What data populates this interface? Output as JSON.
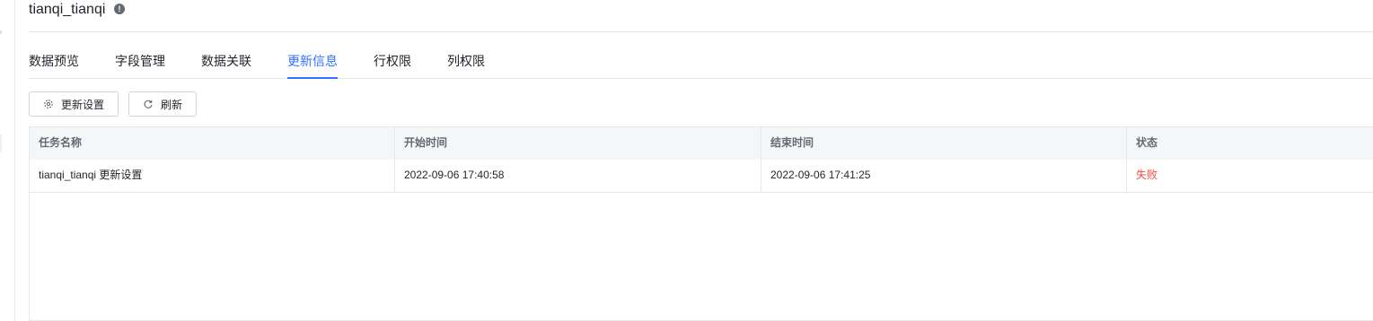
{
  "header": {
    "title": "tianqi_tianqi",
    "info_icon": "info-icon"
  },
  "tabs": [
    {
      "label": "数据预览",
      "active": false
    },
    {
      "label": "字段管理",
      "active": false
    },
    {
      "label": "数据关联",
      "active": false
    },
    {
      "label": "更新信息",
      "active": true
    },
    {
      "label": "行权限",
      "active": false
    },
    {
      "label": "列权限",
      "active": false
    }
  ],
  "toolbar": {
    "settings_label": "更新设置",
    "settings_icon": "gear-icon",
    "refresh_label": "刷新",
    "refresh_icon": "refresh-icon"
  },
  "table": {
    "columns": [
      "任务名称",
      "开始时间",
      "结束时间",
      "状态"
    ],
    "rows": [
      {
        "task_name": "tianqi_tianqi 更新设置",
        "start_time": "2022-09-06 17:40:58",
        "end_time": "2022-09-06 17:41:25",
        "status": "失败"
      }
    ]
  },
  "colors": {
    "accent": "#3370ff",
    "status_fail": "#f54a45",
    "header_bg": "#f5f6f7",
    "border": "#e6e8eb"
  }
}
